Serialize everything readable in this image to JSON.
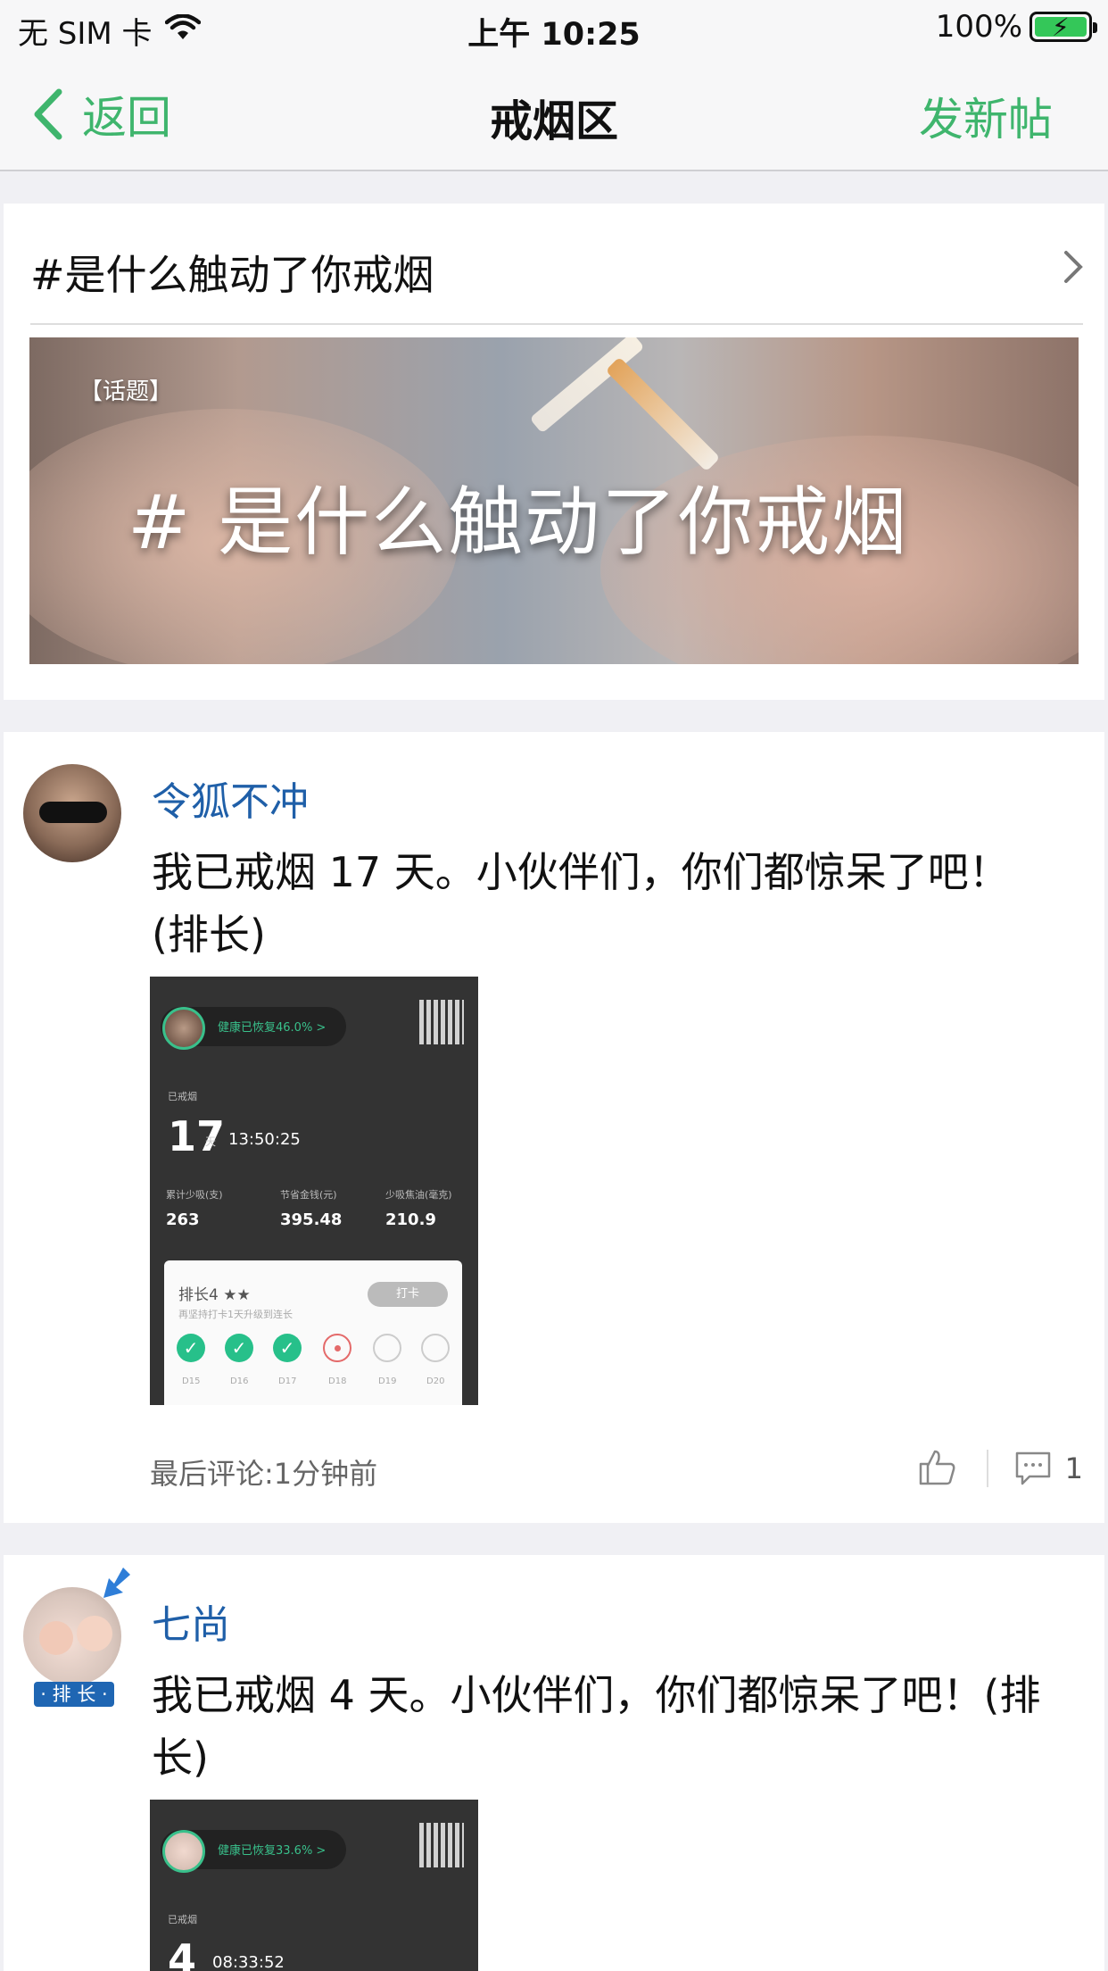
{
  "status": {
    "carrier": "无 SIM 卡",
    "time": "上午 10:25",
    "battery": "100%"
  },
  "nav": {
    "back": "返回",
    "title": "戒烟区",
    "action": "发新帖"
  },
  "topic": {
    "title": "#是什么触动了你戒烟",
    "banner_tag": "【话题】",
    "banner_headline": "# 是什么触动了你戒烟"
  },
  "posts": [
    {
      "author": "令狐不冲",
      "content": "我已戒烟 17 天。小伙伴们，你们都惊呆了吧！(排长)",
      "card": {
        "health": "健康已恢复46.0% >",
        "label_quit": "已戒烟",
        "days": "17",
        "days_unit": "天",
        "time": "13:50:25",
        "stat_labels": [
          "累计少吸(支)",
          "节省金钱(元)",
          "少吸焦油(毫克)"
        ],
        "stat_values": [
          "263",
          "395.48",
          "210.9"
        ],
        "rank": "排长4 ★★",
        "rank_hint": "再坚持打卡1天升级到连长",
        "checkin_btn": "打卡",
        "days_row": [
          "D15",
          "D16",
          "D17",
          "D18",
          "D19",
          "D20"
        ]
      },
      "last_comment": "最后评论:1分钟前",
      "comment_count": "1"
    },
    {
      "author": "七尚",
      "badge": "· 排 长 ·",
      "content": "我已戒烟 4 天。小伙伴们，你们都惊呆了吧！(排长)",
      "card": {
        "health": "健康已恢复33.6% >",
        "label_quit": "已戒烟",
        "days": "4",
        "time": "08:33:52"
      }
    }
  ],
  "colors": {
    "accent": "#3fb56d",
    "author": "#1f5fa8",
    "rank_badge": "#1f66b3"
  }
}
